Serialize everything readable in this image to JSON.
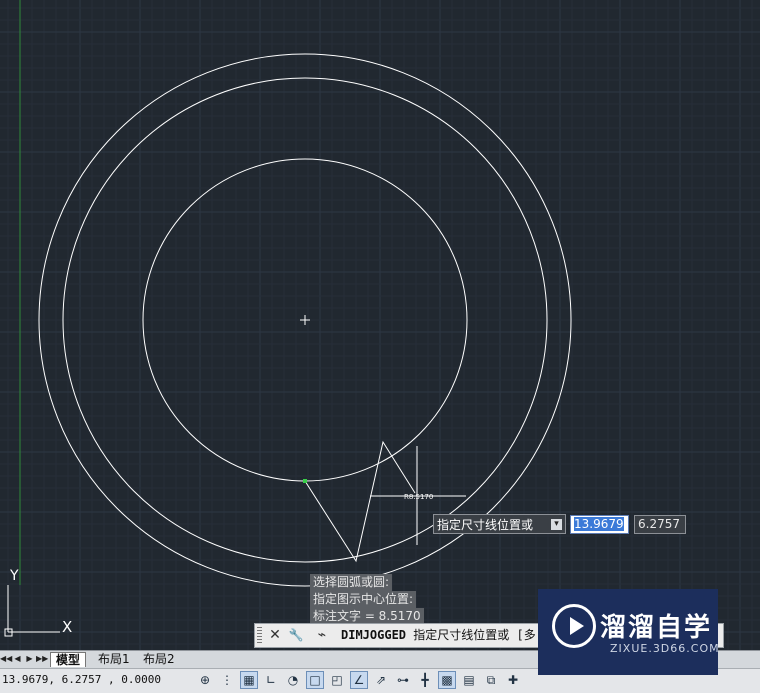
{
  "canvas": {
    "dimension_text": "R8.5170",
    "ucs_x_label": "X",
    "ucs_y_label": "Y"
  },
  "command_history": [
    "选择圆弧或圆:",
    "指定图示中心位置:",
    "标注文字 = 8.5170"
  ],
  "tooltip": {
    "prompt": "指定尺寸线位置或",
    "dropdown_icon": "▾"
  },
  "dynamic_input": {
    "x_value": "13.9679",
    "y_value": "6.2757"
  },
  "command_line": {
    "close_icon": "✕",
    "customize_icon": "🔧",
    "command_icon": "⌁",
    "command_name": "DIMJOGGED",
    "prompt": "指定尺寸线位置或 [多"
  },
  "layout_tabs": {
    "nav": [
      "◀◀",
      "◀",
      "▶",
      "▶▶"
    ],
    "tabs": [
      "模型",
      "布局1",
      "布局2"
    ],
    "active": "模型"
  },
  "status_bar": {
    "coordinates": "13.9679, 6.2757 , 0.0000"
  },
  "watermark": {
    "title": "溜溜自学",
    "subtitle": "ZIXUE.3D66.COM"
  },
  "colors": {
    "canvas_bg": "#212830",
    "grid_major": "#2d3744",
    "grid_minor": "#262e39",
    "geometry": "#ffffff",
    "y_axis": "#2f8a3a",
    "selection_highlight": "#3b7ad8"
  }
}
